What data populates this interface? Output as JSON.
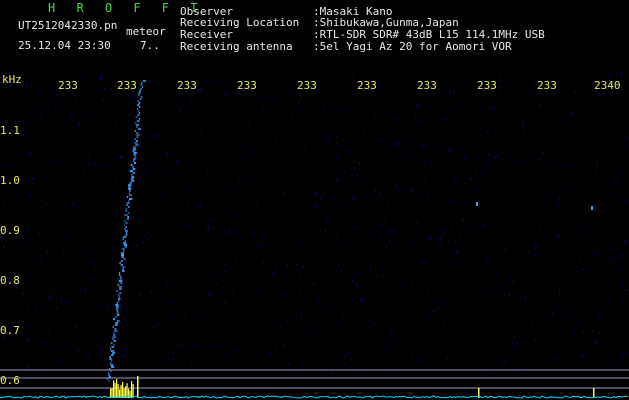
{
  "header": {
    "app_name": "H R O F F T",
    "filename": "UT2512042330.pn",
    "datetime": "25.12.04 23:30",
    "frame_index": "7..",
    "mode": "meteor",
    "observer_label": "Observer",
    "observer_value": ":Masaki Kano",
    "location_label": "Receiving Location",
    "location_value": ":Shibukawa,Gunma,Japan",
    "receiver_label": "Receiver",
    "receiver_value": ":RTL-SDR SDR# 43dB L15 114.1MHz USB",
    "antenna_label": "Receiving antenna",
    "antenna_value": ":5el Yagi Az 20 for Aomori VOR"
  },
  "plot": {
    "y_unit": "kHz",
    "y_ticks": [
      "1.1",
      "1.0",
      "0.9",
      "0.8",
      "0.7",
      "0.6"
    ],
    "x_ticks": [
      "233",
      "233",
      "233",
      "233",
      "233",
      "233",
      "233",
      "233",
      "233",
      "2340"
    ],
    "colors": {
      "background": "#000000",
      "noise": "#0a0a70",
      "trace": "#3aa0ff",
      "axis_text": "#e8e85a",
      "baseline": "#00d0ff",
      "spike": "#ffff40"
    }
  }
}
